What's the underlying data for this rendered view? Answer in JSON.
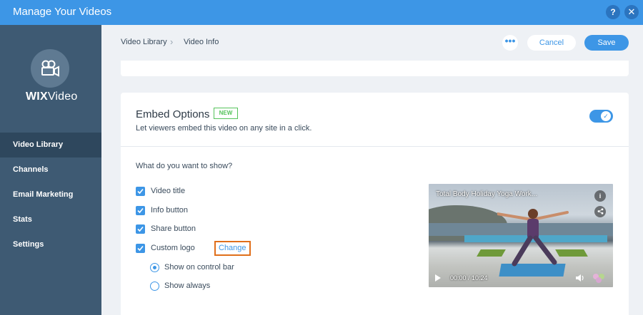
{
  "window": {
    "title": "Manage Your Videos",
    "help_label": "?",
    "close_label": "✕"
  },
  "sidebar": {
    "brand_bold": "WIX",
    "brand_light": "Video",
    "items": [
      {
        "label": "Video Library",
        "active": true
      },
      {
        "label": "Channels"
      },
      {
        "label": "Email Marketing"
      },
      {
        "label": "Stats"
      },
      {
        "label": "Settings"
      }
    ]
  },
  "header": {
    "breadcrumb": [
      "Video Library",
      "Video Info"
    ],
    "more_label": "•••",
    "cancel_label": "Cancel",
    "save_label": "Save"
  },
  "embed": {
    "title": "Embed Options",
    "badge": "NEW",
    "subtitle": "Let viewers embed this video on any site in a click.",
    "enabled": true,
    "question": "What do you want to show?",
    "options": [
      {
        "label": "Video title",
        "checked": true
      },
      {
        "label": "Info button",
        "checked": true
      },
      {
        "label": "Share button",
        "checked": true
      },
      {
        "label": "Custom logo",
        "checked": true
      }
    ],
    "change_label": "Change",
    "logo_modes": [
      {
        "label": "Show on control bar",
        "selected": true
      },
      {
        "label": "Show always",
        "selected": false
      }
    ]
  },
  "preview": {
    "title": "Total Body Holiday Yoga Work...",
    "info_label": "i",
    "time": "00:00 / 10:24"
  },
  "colors": {
    "accent": "#3d96e6",
    "sidebar": "#3e5a73",
    "highlight": "#e06f1b",
    "new_badge": "#55c35b"
  }
}
